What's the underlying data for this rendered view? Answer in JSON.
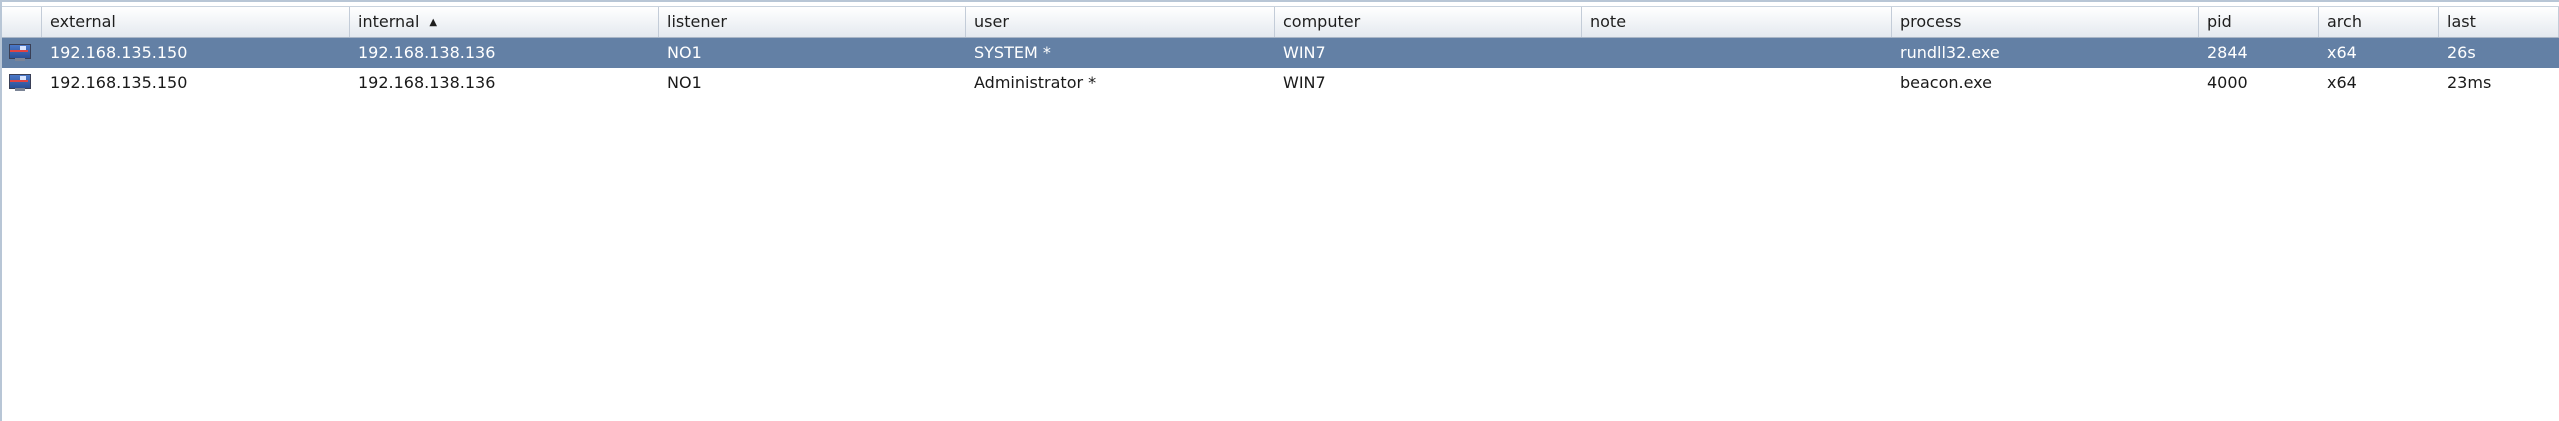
{
  "table": {
    "columns": [
      {
        "key": "icon",
        "label": ""
      },
      {
        "key": "external",
        "label": "external"
      },
      {
        "key": "internal",
        "label": "internal",
        "sorted": "asc"
      },
      {
        "key": "listener",
        "label": "listener"
      },
      {
        "key": "user",
        "label": "user"
      },
      {
        "key": "computer",
        "label": "computer"
      },
      {
        "key": "note",
        "label": "note"
      },
      {
        "key": "process",
        "label": "process"
      },
      {
        "key": "pid",
        "label": "pid"
      },
      {
        "key": "arch",
        "label": "arch"
      },
      {
        "key": "last",
        "label": "last"
      }
    ],
    "sort_indicator": "▲",
    "rows": [
      {
        "icon": "beacon-monitor-icon",
        "external": "192.168.135.150",
        "internal": "192.168.138.136",
        "listener": "NO1",
        "user": "SYSTEM *",
        "computer": "WIN7",
        "note": "",
        "process": "rundll32.exe",
        "pid": "2844",
        "arch": "x64",
        "last": "26s",
        "selected": true
      },
      {
        "icon": "beacon-monitor-icon",
        "external": "192.168.135.150",
        "internal": "192.168.138.136",
        "listener": "NO1",
        "user": "Administrator *",
        "computer": "WIN7",
        "note": "",
        "process": "beacon.exe",
        "pid": "4000",
        "arch": "x64",
        "last": "23ms",
        "selected": false
      }
    ]
  },
  "colors": {
    "selected_row": "#6380a5",
    "header_gradient_top": "#ffffff",
    "header_gradient_bottom": "#e4e9ef"
  }
}
